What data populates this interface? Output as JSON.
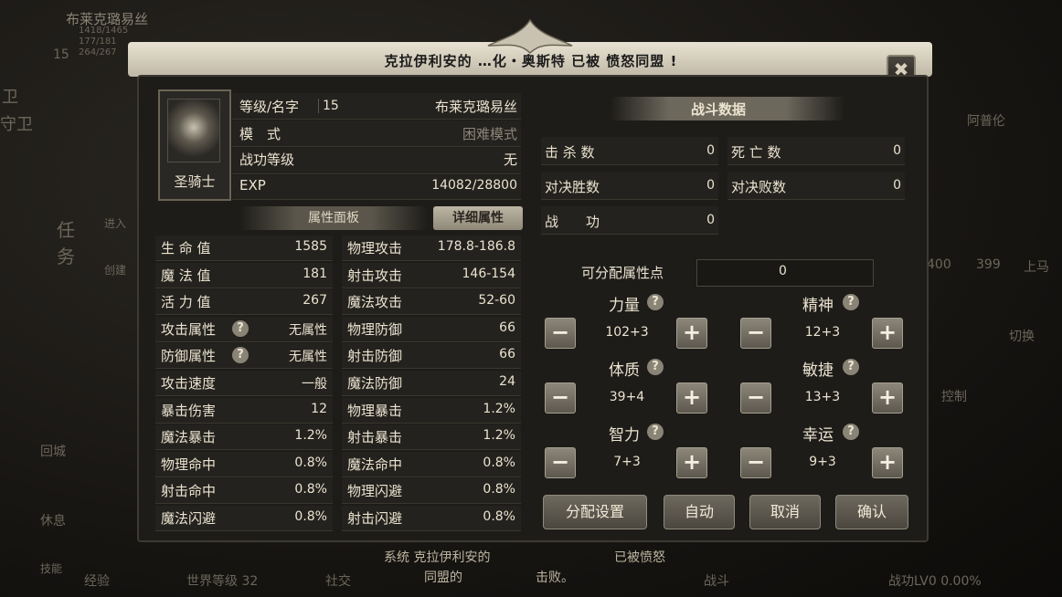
{
  "background": {
    "player_name": "布莱克璐易丝",
    "hp": "1418/1465",
    "mp": "177/181",
    "stamina": "264/267",
    "level": "15",
    "left_items": [
      "卫",
      "守卫",
      "任务",
      "回城",
      "休息",
      "技能",
      "进入",
      "创建"
    ],
    "right_items": [
      "阿普伦",
      "400",
      "399",
      "上马",
      "切换",
      "控制"
    ],
    "bottom_items": [
      "经验",
      "世界等级 32",
      "社交",
      "战斗",
      "战功LV0 0.00%"
    ],
    "chat_line1": "系统 克拉伊利安的",
    "chat_line1b": "已被愤怒",
    "chat_line2": "同盟的",
    "chat_line2b": "击败。"
  },
  "banner": {
    "text": "克拉伊利安的 …化・奥斯特 已被 愤怒同盟 !"
  },
  "close_label": "✖",
  "profile": {
    "class_name": "圣骑士",
    "rows": [
      {
        "label": "等级/名字",
        "level": "15",
        "name": "布莱克璐易丝"
      },
      {
        "label": "模　式",
        "value": "困难模式"
      },
      {
        "label": "战功等级",
        "value": "无"
      },
      {
        "label": "EXP",
        "value": "14082/28800"
      }
    ]
  },
  "tabs": {
    "attributes": "属性面板",
    "detailed": "详细属性"
  },
  "stats_left": [
    {
      "label": "生 命 值",
      "value": "1585"
    },
    {
      "label": "魔 法 值",
      "value": "181"
    },
    {
      "label": "活 力 值",
      "value": "267"
    },
    {
      "label": "攻击属性",
      "value": "无属性",
      "help": "?"
    },
    {
      "label": "防御属性",
      "value": "无属性",
      "help": "?"
    },
    {
      "label": "攻击速度",
      "value": "一般"
    },
    {
      "label": "暴击伤害",
      "value": "12"
    },
    {
      "label": "魔法暴击",
      "value": "1.2%"
    },
    {
      "label": "物理命中",
      "value": "0.8%"
    },
    {
      "label": "射击命中",
      "value": "0.8%"
    },
    {
      "label": "魔法闪避",
      "value": "0.8%"
    }
  ],
  "stats_right": [
    {
      "label": "物理攻击",
      "value": "178.8-186.8"
    },
    {
      "label": "射击攻击",
      "value": "146-154"
    },
    {
      "label": "魔法攻击",
      "value": "52-60"
    },
    {
      "label": "物理防御",
      "value": "66"
    },
    {
      "label": "射击防御",
      "value": "66"
    },
    {
      "label": "魔法防御",
      "value": "24"
    },
    {
      "label": "物理暴击",
      "value": "1.2%"
    },
    {
      "label": "射击暴击",
      "value": "1.2%"
    },
    {
      "label": "魔法命中",
      "value": "0.8%"
    },
    {
      "label": "物理闪避",
      "value": "0.8%"
    },
    {
      "label": "射击闪避",
      "value": "0.8%"
    }
  ],
  "battle": {
    "title": "战斗数据",
    "kills_label": "击 杀 数",
    "kills": "0",
    "deaths_label": "死 亡 数",
    "deaths": "0",
    "wins_label": "对决胜数",
    "wins": "0",
    "losses_label": "对决败数",
    "losses": "0",
    "merit_label": "战　　功",
    "merit": "0"
  },
  "allocation": {
    "points_label": "可分配属性点",
    "points": "0",
    "help": "?",
    "minus": "−",
    "plus": "+",
    "attrs": [
      {
        "label": "力量",
        "value": "102+3"
      },
      {
        "label": "精神",
        "value": "12+3"
      },
      {
        "label": "体质",
        "value": "39+4"
      },
      {
        "label": "敏捷",
        "value": "13+3"
      },
      {
        "label": "智力",
        "value": "7+3"
      },
      {
        "label": "幸运",
        "value": "9+3"
      }
    ]
  },
  "actions": {
    "settings": "分配设置",
    "auto": "自动",
    "cancel": "取消",
    "confirm": "确认"
  }
}
